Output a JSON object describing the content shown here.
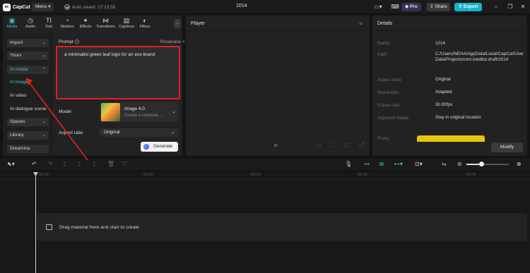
{
  "app": {
    "name": "CapCut",
    "menu_label": "Menu",
    "autosave_text": "Auto saved: 17:13:55",
    "project_title": "1014",
    "pro_label": "Pro",
    "share_label": "Share",
    "export_label": "Export",
    "accent_color": "#3cc6d4",
    "export_color": "#16b4c8"
  },
  "top_tabs": [
    {
      "label": "Media",
      "icon": "media-icon",
      "active": true
    },
    {
      "label": "Audio",
      "icon": "audio-icon"
    },
    {
      "label": "Text",
      "icon": "text-icon"
    },
    {
      "label": "Stickers",
      "icon": "stickers-icon"
    },
    {
      "label": "Effects",
      "icon": "effects-icon"
    },
    {
      "label": "Transitions",
      "icon": "transitions-icon"
    },
    {
      "label": "Captions",
      "icon": "captions-icon"
    },
    {
      "label": "Filters",
      "icon": "filters-icon"
    }
  ],
  "sidebar": {
    "import": "Import",
    "yours": "Yours",
    "ai_media": "AI media",
    "ai_image": "AI image",
    "ai_video": "AI video",
    "ai_dialogue": "AI dialogue scene",
    "spaces": "Spaces",
    "library": "Library",
    "dreamina": "Dreamina"
  },
  "ai_image": {
    "prompt_label": "Prompt",
    "showcase": "Showcase >",
    "prompt_text": "a minimalist green leaf logo for an eco brand",
    "model_label": "Model",
    "model_name": "Image 4.0",
    "model_desc": "Create a cohesive ...",
    "aspect_label": "Aspect ratio",
    "aspect_value": "Original",
    "generate_label": "Generate"
  },
  "player": {
    "title": "Player"
  },
  "details": {
    "title": "Details",
    "rows": [
      {
        "key": "Name:",
        "value": "1014"
      },
      {
        "key": "Path:",
        "value": "C:/Users/NEHA/AppData/Local/CapCut/User Data/Projects/com.lveditor.draft/1014"
      },
      {
        "key": "Aspect ratio:",
        "value": "Original"
      },
      {
        "key": "Resolution:",
        "value": "Adapted"
      },
      {
        "key": "Frame rate:",
        "value": "30.00fps"
      },
      {
        "key": "Imported media:",
        "value": "Stay in original location"
      },
      {
        "key": "Proxy:",
        "value": ""
      }
    ],
    "modify_label": "Modify"
  },
  "timeline": {
    "ticks": [
      "00:00",
      "00:02",
      "00:04",
      "00:06",
      "00:08"
    ],
    "empty_track_text": "Drag material here and start to create"
  },
  "annotation": {
    "highlight_color": "#e02020"
  }
}
